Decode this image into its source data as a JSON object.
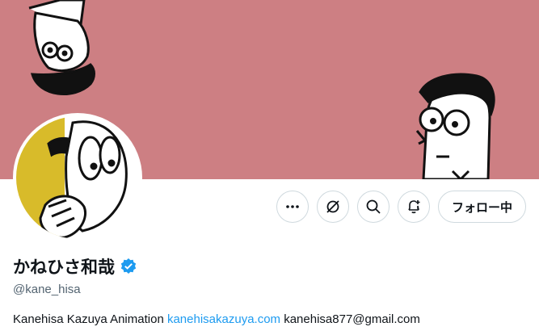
{
  "theme": {
    "banner_color": "#cd7f83",
    "accent": "#1d9bf0",
    "avatar_yellow": "#d8bb2a",
    "text_primary": "#0f1419",
    "text_secondary": "#536471"
  },
  "icons": {
    "more": "more-horizontal-icon",
    "grok": "grok-icon",
    "search": "search-icon",
    "notify": "bell-plus-icon",
    "verified": "verified-badge-icon"
  },
  "actions": {
    "follow_label": "フォロー中"
  },
  "profile": {
    "display_name": "かねひさ和哉",
    "handle": "@kane_hisa",
    "bio_text": "Kanehisa Kazuya Animation",
    "bio_link": "kanehisakazuya.com",
    "bio_email": "kanehisa877@gmail.com"
  }
}
